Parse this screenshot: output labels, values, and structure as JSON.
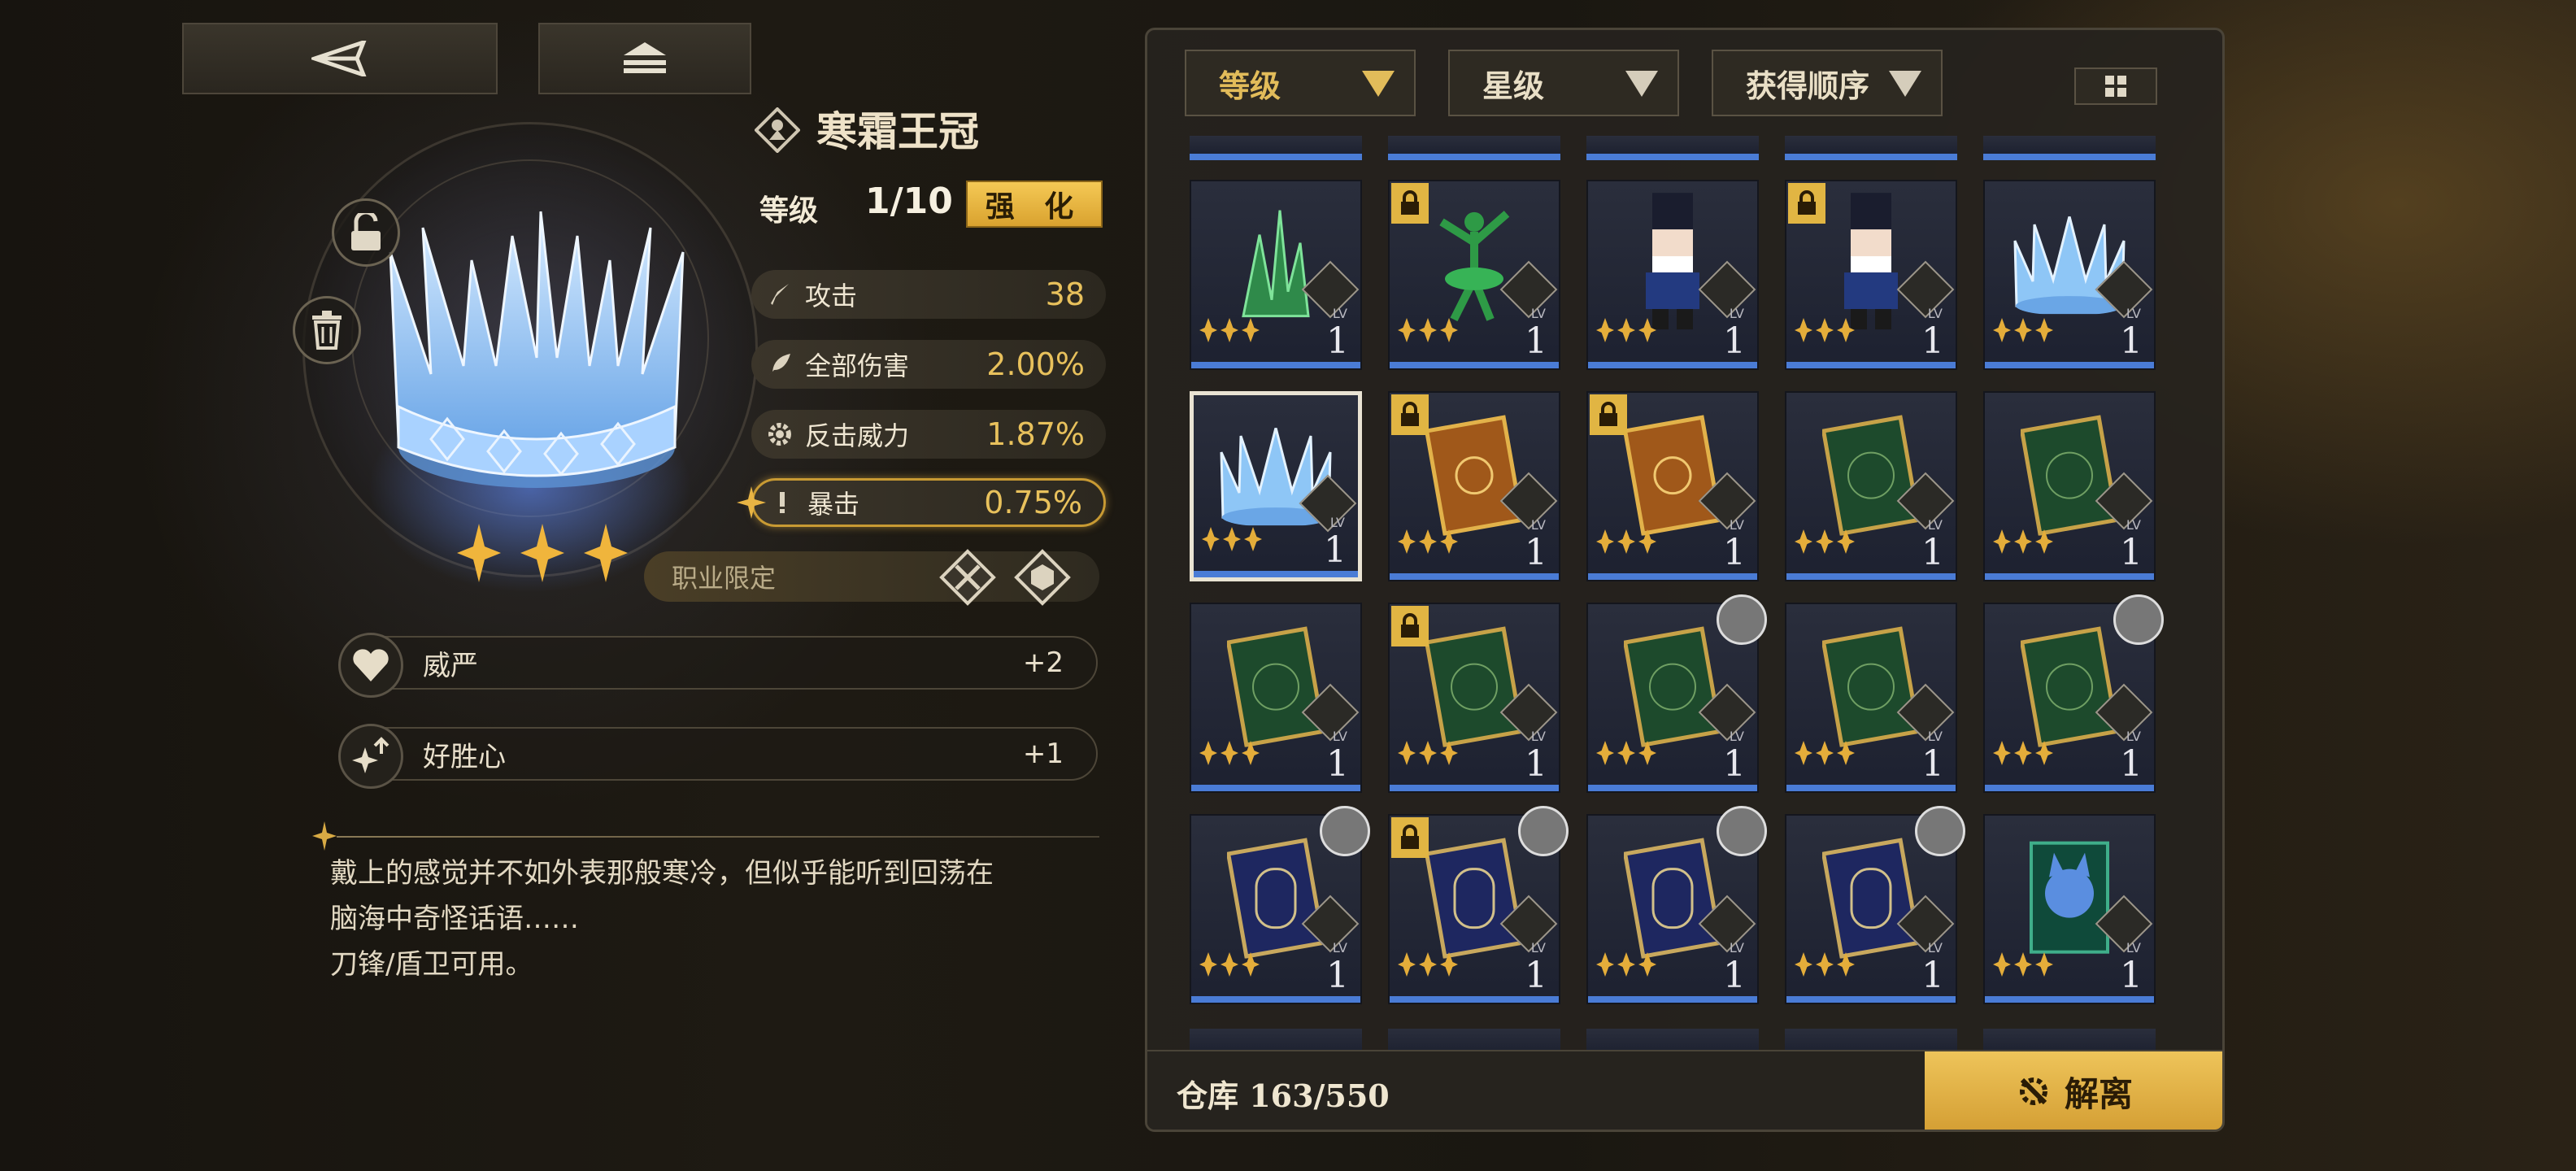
{
  "nav": {
    "back_icon": "back-arrow-icon",
    "home_icon": "home-stack-icon"
  },
  "item": {
    "name": "寒霜王冠",
    "level_label": "等级",
    "level_value": "1/10",
    "enhance_label": "强 化",
    "stars": 3,
    "stats": [
      {
        "icon": "sword-icon",
        "label": "攻击",
        "value": "38"
      },
      {
        "icon": "feather-icon",
        "label": "全部伤害",
        "value": "2.00%"
      },
      {
        "icon": "gear-icon",
        "label": "反击威力",
        "value": "1.87%"
      },
      {
        "icon": "exclaim-icon",
        "label": "暴击",
        "value": "0.75%"
      }
    ],
    "job_label": "职业限定",
    "traits": [
      {
        "icon": "heart-icon",
        "name": "威严",
        "value": "+2"
      },
      {
        "icon": "sparkle-up-icon",
        "name": "好胜心",
        "value": "+1"
      }
    ],
    "description": "戴上的感觉并不如外表那般寒冷，但似乎能听到回荡在\n脑海中奇怪话语……\n 刀锋/盾卫可用。"
  },
  "filters": [
    {
      "label": "等级"
    },
    {
      "label": "星级"
    },
    {
      "label": "获得顺序"
    }
  ],
  "inventory": {
    "lv_text": "LV",
    "cards": [
      {
        "art": "green-crystal",
        "level": "1",
        "lock": false,
        "avatar": false,
        "selected": false
      },
      {
        "art": "green-dancer",
        "level": "1",
        "lock": true,
        "avatar": false,
        "selected": false
      },
      {
        "art": "nutcracker",
        "level": "1",
        "lock": false,
        "avatar": false,
        "selected": false
      },
      {
        "art": "nutcracker",
        "level": "1",
        "lock": true,
        "avatar": false,
        "selected": false
      },
      {
        "art": "ice-crown",
        "level": "1",
        "lock": false,
        "avatar": false,
        "selected": false
      },
      {
        "art": "ice-crown",
        "level": "1",
        "lock": false,
        "avatar": false,
        "selected": true
      },
      {
        "art": "orange-book",
        "level": "1",
        "lock": true,
        "avatar": false,
        "selected": false
      },
      {
        "art": "orange-book",
        "level": "1",
        "lock": true,
        "avatar": false,
        "selected": false
      },
      {
        "art": "green-book",
        "level": "1",
        "lock": false,
        "avatar": false,
        "selected": false
      },
      {
        "art": "green-book",
        "level": "1",
        "lock": false,
        "avatar": false,
        "selected": false
      },
      {
        "art": "green-book",
        "level": "1",
        "lock": false,
        "avatar": false,
        "selected": false
      },
      {
        "art": "green-book",
        "level": "1",
        "lock": true,
        "avatar": false,
        "selected": false
      },
      {
        "art": "green-book",
        "level": "1",
        "lock": false,
        "avatar": true,
        "selected": false
      },
      {
        "art": "green-book",
        "level": "1",
        "lock": false,
        "avatar": false,
        "selected": false
      },
      {
        "art": "green-book",
        "level": "1",
        "lock": false,
        "avatar": true,
        "selected": false
      },
      {
        "art": "blue-book",
        "level": "1",
        "lock": false,
        "avatar": true,
        "selected": false
      },
      {
        "art": "blue-book",
        "level": "1",
        "lock": true,
        "avatar": true,
        "selected": false
      },
      {
        "art": "blue-book",
        "level": "1",
        "lock": false,
        "avatar": true,
        "selected": false
      },
      {
        "art": "blue-book",
        "level": "1",
        "lock": false,
        "avatar": true,
        "selected": false
      },
      {
        "art": "cat-card",
        "level": "1",
        "lock": false,
        "avatar": false,
        "selected": false
      }
    ]
  },
  "footer": {
    "storage": "仓库 163/550",
    "dismantle_label": "解离"
  },
  "colors": {
    "accent": "#e2b84f",
    "level_bar": "#4a7cd6",
    "star": "#e4ad3a"
  }
}
